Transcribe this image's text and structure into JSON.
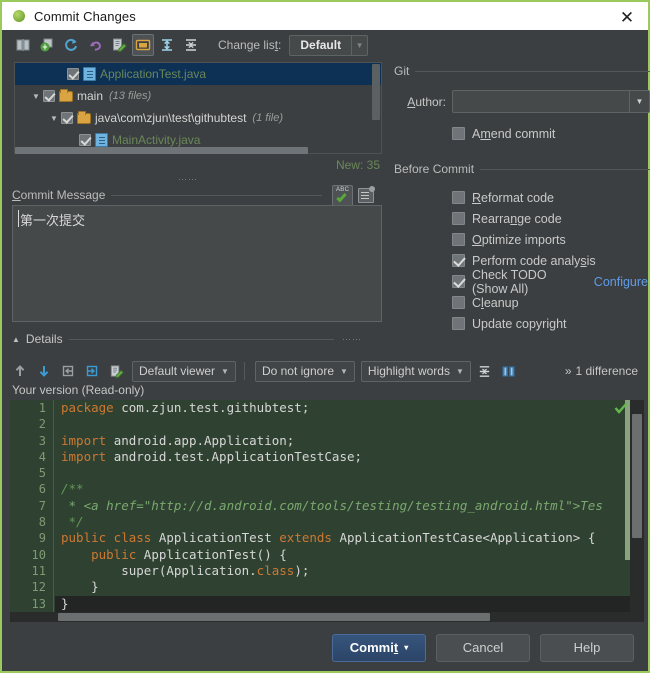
{
  "window": {
    "title": "Commit Changes",
    "app_icon": "android-leaf-icon",
    "close_label": "✕"
  },
  "toolbar": {
    "icons": [
      "show-diff-icon",
      "revert-icon-green",
      "refresh-icon",
      "rollback-icon",
      "edit-source-icon",
      "group-by-directory-icon",
      "expand-all-icon",
      "collapse-all-icon"
    ],
    "changelist_label": "Change list:",
    "changelist_value": "Default"
  },
  "tree": {
    "rows": [
      {
        "name": "ApplicationTest.java",
        "meta": "",
        "icon": "java-file-icon",
        "indent": 3,
        "twisty": "",
        "selected": true,
        "color": "green"
      },
      {
        "name": "main",
        "meta": "(13 files)",
        "icon": "folder-icon",
        "indent": 1,
        "twisty": "▼",
        "selected": false,
        "color": "plain"
      },
      {
        "name": "java\\com\\zjun\\test\\githubtest",
        "meta": "(1 file)",
        "icon": "folder-icon",
        "indent": 2,
        "twisty": "▼",
        "selected": false,
        "color": "plain"
      },
      {
        "name": "MainActivity.java",
        "meta": "",
        "icon": "java-file-icon",
        "indent": 3,
        "twisty": "",
        "selected": false,
        "color": "green"
      }
    ],
    "new_count": "New: 35"
  },
  "commit_message": {
    "label": "Commit Message",
    "label_mnemonic": "C",
    "value": "第一次提交",
    "spellcheck_icon": "spellcheck-abc-icon",
    "history_icon": "message-history-icon"
  },
  "git": {
    "section_label": "Git",
    "author_label": "Author:",
    "author_mnemonic": "A",
    "author_value": "",
    "amend_label": "Amend commit",
    "amend_mnemonic": "A",
    "amend_checked": false
  },
  "before_commit": {
    "section_label": "Before Commit",
    "items": [
      {
        "label": "Reformat code",
        "mnemonic": "R",
        "checked": false
      },
      {
        "label": "Rearrange code",
        "mnemonic": "n",
        "checked": false
      },
      {
        "label": "Optimize imports",
        "mnemonic": "O",
        "checked": false
      },
      {
        "label": "Perform code analysis",
        "mnemonic": "s",
        "checked": true
      },
      {
        "label": "Check TODO (Show All)",
        "mnemonic": "",
        "checked": true,
        "link": "Configure"
      },
      {
        "label": "Cleanup",
        "mnemonic": "l",
        "checked": false
      },
      {
        "label": "Update copyright",
        "mnemonic": "",
        "checked": false
      }
    ]
  },
  "details": {
    "label": "Details",
    "collapse_triangle": "▲",
    "toolbar_icons": [
      "previous-difference-icon",
      "next-difference-icon",
      "apply-left-icon",
      "apply-right-icon",
      "edit-source-icon"
    ],
    "viewer_select": "Default viewer",
    "ignore_select": "Do not ignore",
    "highlight_select": "Highlight words",
    "collapse_unchanged_icon": "collapse-unchanged-icon",
    "side_by_side_icon": "side-by-side-view-icon",
    "difference_count": "1 difference",
    "difference_chevron": "»",
    "version_label": "Your version (Read-only)"
  },
  "code": {
    "lines": [
      {
        "num": "1",
        "dark": false,
        "tokens": [
          {
            "t": "package ",
            "c": "kw"
          },
          {
            "t": "com.zjun.test.githubtest;",
            "c": "pl"
          }
        ]
      },
      {
        "num": "2",
        "dark": false,
        "tokens": []
      },
      {
        "num": "3",
        "dark": false,
        "tokens": [
          {
            "t": "import ",
            "c": "kw"
          },
          {
            "t": "android.app.Application;",
            "c": "pl"
          }
        ]
      },
      {
        "num": "4",
        "dark": false,
        "tokens": [
          {
            "t": "import ",
            "c": "kw"
          },
          {
            "t": "android.test.ApplicationTestCase;",
            "c": "pl"
          }
        ]
      },
      {
        "num": "5",
        "dark": false,
        "tokens": []
      },
      {
        "num": "6",
        "dark": false,
        "tokens": [
          {
            "t": "/**",
            "c": "cm"
          }
        ]
      },
      {
        "num": "7",
        "dark": false,
        "tokens": [
          {
            "t": " * <a href=\"http://d.android.com/tools/testing/testing_android.html\">Tes",
            "c": "cm-b"
          }
        ]
      },
      {
        "num": "8",
        "dark": false,
        "tokens": [
          {
            "t": " */",
            "c": "cm"
          }
        ]
      },
      {
        "num": "9",
        "dark": false,
        "tokens": [
          {
            "t": "public class ",
            "c": "kw"
          },
          {
            "t": "ApplicationTest ",
            "c": "pl"
          },
          {
            "t": "extends ",
            "c": "kw"
          },
          {
            "t": "ApplicationTestCase<Application> {",
            "c": "pl"
          }
        ]
      },
      {
        "num": "10",
        "dark": false,
        "tokens": [
          {
            "t": "    public ",
            "c": "kw"
          },
          {
            "t": "ApplicationTest() {",
            "c": "pl"
          }
        ]
      },
      {
        "num": "11",
        "dark": false,
        "tokens": [
          {
            "t": "        super(Application.",
            "c": "pl"
          },
          {
            "t": "class",
            "c": "kw"
          },
          {
            "t": ");",
            "c": "pl"
          }
        ]
      },
      {
        "num": "12",
        "dark": false,
        "tokens": [
          {
            "t": "    }",
            "c": "pl"
          }
        ]
      },
      {
        "num": "13",
        "dark": true,
        "tokens": [
          {
            "t": "}",
            "c": "pl"
          }
        ]
      }
    ],
    "status_check_icon": "analysis-ok-check-icon"
  },
  "footer": {
    "commit_label": "Commit",
    "commit_mnemonic": "t",
    "commit_caret": "▾",
    "cancel_label": "Cancel",
    "help_label": "Help"
  },
  "colors": {
    "accent_green": "#9aca5c",
    "window_bg": "#3c3f41",
    "editor_bg": "#2f4231",
    "selection_blue": "#0d3055",
    "link_blue": "#5f9ce8",
    "green_text": "#6a8759",
    "primary_button": "#37557c"
  }
}
